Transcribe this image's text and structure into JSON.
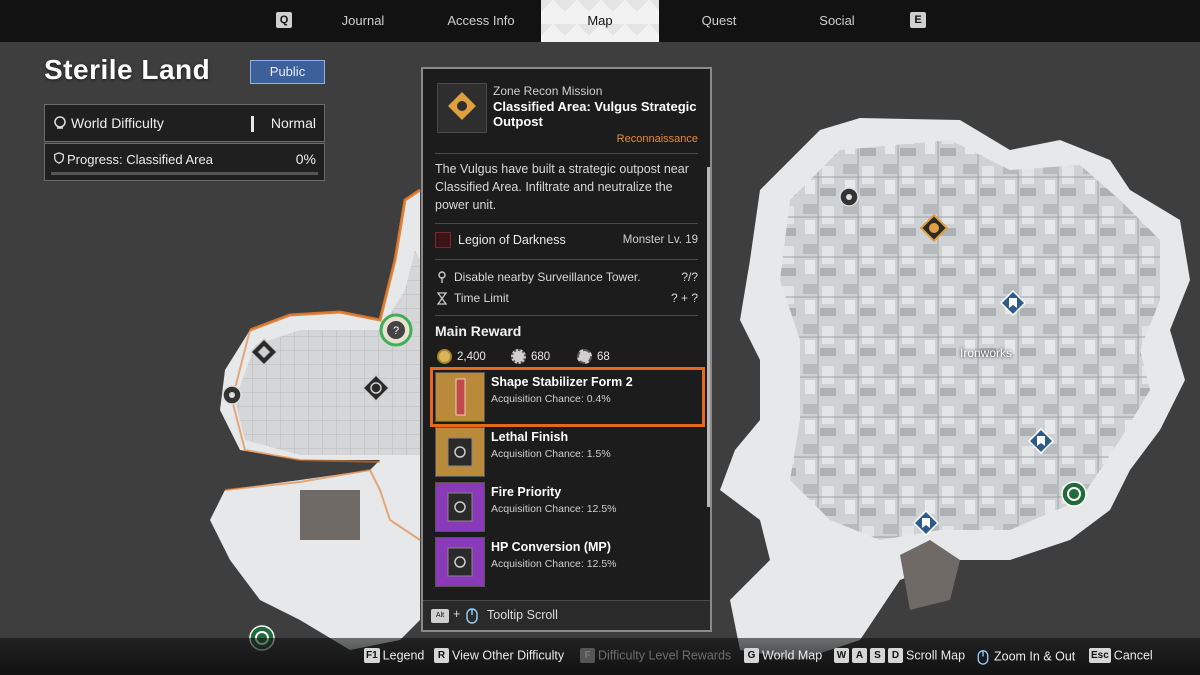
{
  "nav": {
    "key_left": "Q",
    "key_right": "E",
    "tabs": [
      {
        "label": "Journal"
      },
      {
        "label": "Access Info"
      },
      {
        "label": "Map"
      },
      {
        "label": "Quest"
      },
      {
        "label": "Social"
      }
    ],
    "active_tab": "Map"
  },
  "zone": {
    "title": "Sterile Land",
    "visibility_button": "Public",
    "difficulty_label": "World Difficulty",
    "difficulty_value": "Normal",
    "progress_label": "Progress: Classified Area",
    "progress_value": "0%",
    "progress_fraction": 0
  },
  "map": {
    "location_label": "Ironworks"
  },
  "mission": {
    "type": "Zone Recon Mission",
    "name": "Classified Area: Vulgus Strategic Outpost",
    "category": "Reconnaissance",
    "description": "The Vulgus have built a strategic outpost near Classified Area. Infiltrate and neutralize the power unit.",
    "faction": "Legion of Darkness",
    "monster_level": "Monster Lv. 19",
    "objectives": [
      {
        "text": "Disable nearby Surveillance Tower.",
        "value": "?/?"
      },
      {
        "text": "Time Limit",
        "value": "? + ?"
      }
    ],
    "reward_title": "Main Reward",
    "currencies": [
      {
        "icon": "gold-coin-icon",
        "value": "2,400"
      },
      {
        "icon": "kuiper-shard-icon",
        "value": "680"
      },
      {
        "icon": "gear-icon",
        "value": "68"
      }
    ],
    "rewards": [
      {
        "name": "Shape Stabilizer Form 2",
        "chance": "Acquisition Chance: 0.4%",
        "rarity_color": "#b88a3a",
        "highlighted": true
      },
      {
        "name": "Lethal Finish",
        "chance": "Acquisition Chance: 1.5%",
        "rarity_color": "#b88a3a",
        "highlighted": false
      },
      {
        "name": "Fire Priority",
        "chance": "Acquisition Chance: 12.5%",
        "rarity_color": "#8a3ab8",
        "highlighted": false
      },
      {
        "name": "HP Conversion (MP)",
        "chance": "Acquisition Chance: 12.5%",
        "rarity_color": "#8a3ab8",
        "highlighted": false
      }
    ],
    "footer_key": "Alt",
    "footer_plus": "+",
    "footer_text": "Tooltip Scroll"
  },
  "hints": [
    {
      "key": "F1",
      "label": "Legend",
      "disabled": false
    },
    {
      "key": "R",
      "label": "View Other Difficulty",
      "disabled": false
    },
    {
      "key": "F",
      "label": "Difficulty Level Rewards",
      "disabled": true
    },
    {
      "key": "G",
      "label": "World Map",
      "disabled": false
    },
    {
      "keys": [
        "W",
        "A",
        "S",
        "D"
      ],
      "label": "Scroll Map",
      "disabled": false
    },
    {
      "key": "",
      "label": "Zoom In & Out",
      "disabled": false
    },
    {
      "key": "Esc",
      "label": "Cancel",
      "disabled": false
    }
  ],
  "colors": {
    "accent_orange": "#e8671e",
    "public_blue": "#3d5f9a",
    "category_orange": "#e58a3c"
  }
}
